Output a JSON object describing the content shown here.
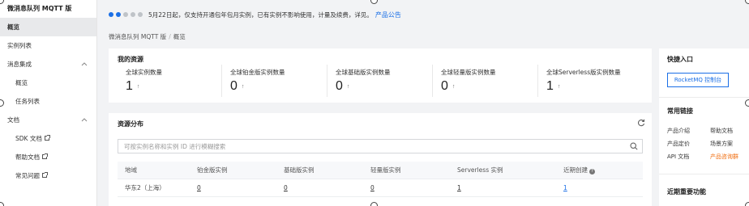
{
  "sidebar": {
    "title": "微消息队列 MQTT 版",
    "items": [
      {
        "label": "概览",
        "active": true
      },
      {
        "label": "实例列表"
      },
      {
        "label": "消息集成",
        "chevron": "^"
      },
      {
        "label": "概览",
        "sub": true
      },
      {
        "label": "任务列表",
        "sub": true
      },
      {
        "label": "文档",
        "chevron": "^"
      },
      {
        "label": "SDK 文档",
        "sub": true,
        "external": true
      },
      {
        "label": "帮助文档",
        "sub": true,
        "external": true
      },
      {
        "label": "常见问题",
        "sub": true,
        "external": true
      }
    ]
  },
  "notice": {
    "text": "5月22日起，仅支持开通包年包月实例，已有实例不影响使用，计量及续费，详见。",
    "link": "产品公告",
    "dots_total": 5,
    "dots_active": 2
  },
  "breadcrumb": {
    "root": "微消息队列 MQTT 版",
    "sep": "/",
    "current": "概览"
  },
  "resources": {
    "title": "我的资源",
    "stats": [
      {
        "label": "全球实例数量",
        "value": "1"
      },
      {
        "label": "全球铂金版实例数量",
        "value": "0"
      },
      {
        "label": "全球基础版实例数量",
        "value": "0"
      },
      {
        "label": "全球轻量版实例数量",
        "value": "0"
      },
      {
        "label": "全球Serverless版实例数量",
        "value": "1"
      }
    ],
    "arrow": "↑"
  },
  "distribution": {
    "title": "资源分布",
    "search_placeholder": "可按实例名称和实例 ID 进行模糊搜索",
    "columns": [
      "地域",
      "铂金版实例",
      "基础版实例",
      "轻量版实例",
      "Serverless 实例",
      "近期创建"
    ],
    "help_glyph": "?",
    "rows": [
      {
        "region": "华东2（上海）",
        "platinum": "0",
        "basic": "0",
        "light": "0",
        "serverless": "1",
        "recent": "1"
      }
    ]
  },
  "right_panel": {
    "quick_title": "快捷入口",
    "quick_button": "RocketMQ 控制台",
    "links_title": "常用链接",
    "links": [
      {
        "label": "产品介绍"
      },
      {
        "label": "帮助文档"
      },
      {
        "label": "产品定价"
      },
      {
        "label": "场景方案"
      },
      {
        "label": "API 文档"
      },
      {
        "label": "产品咨询群",
        "highlight": true
      }
    ],
    "recent_title": "近期重要功能"
  },
  "colors": {
    "accent": "#1b6fe6",
    "orange": "#f06a0a",
    "page_bg": "#f2f3f5"
  }
}
